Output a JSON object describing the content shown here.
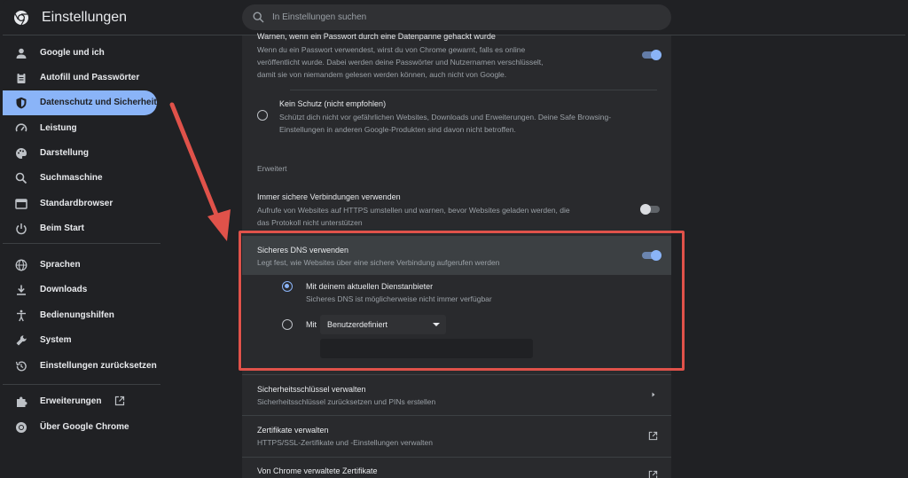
{
  "app": {
    "title": "Einstellungen"
  },
  "search": {
    "placeholder": "In Einstellungen suchen"
  },
  "sidebar": {
    "items": [
      {
        "label": "Google und ich",
        "icon": "person-icon"
      },
      {
        "label": "Autofill und Passwörter",
        "icon": "clipboard-icon"
      },
      {
        "label": "Datenschutz und Sicherheit",
        "icon": "shield-icon",
        "active": true
      },
      {
        "label": "Leistung",
        "icon": "speedometer-icon"
      },
      {
        "label": "Darstellung",
        "icon": "palette-icon"
      },
      {
        "label": "Suchmaschine",
        "icon": "search-icon"
      },
      {
        "label": "Standardbrowser",
        "icon": "browser-icon"
      },
      {
        "label": "Beim Start",
        "icon": "power-icon"
      },
      {
        "label": "Sprachen",
        "icon": "globe-icon"
      },
      {
        "label": "Downloads",
        "icon": "download-icon"
      },
      {
        "label": "Bedienungshilfen",
        "icon": "accessibility-icon"
      },
      {
        "label": "System",
        "icon": "wrench-icon"
      },
      {
        "label": "Einstellungen zurücksetzen",
        "icon": "history-icon"
      },
      {
        "label": "Erweiterungen",
        "icon": "puzzle-icon"
      },
      {
        "label": "Über Google Chrome",
        "icon": "chrome-icon"
      }
    ]
  },
  "content": {
    "breach_warning": {
      "title": "Warnen, wenn ein Passwort durch eine Datenpanne gehackt wurde",
      "desc_line1": "Wenn du ein Passwort verwendest, wirst du von Chrome gewarnt, falls es online",
      "desc_line2": "veröffentlicht wurde. Dabei werden deine Passwörter und Nutzernamen verschlüsselt,",
      "desc_line3": "damit sie von niemandem gelesen werden können, auch nicht von Google.",
      "enabled": true
    },
    "no_protection": {
      "title": "Kein Schutz (nicht empfohlen)",
      "desc_line1": "Schützt dich nicht vor gefährlichen Websites, Downloads und Erweiterungen. Deine Safe Browsing-",
      "desc_line2": "Einstellungen in anderen Google-Produkten sind davon nicht betroffen."
    },
    "advanced_heading": "Erweitert",
    "https_always": {
      "title": "Immer sichere Verbindungen verwenden",
      "desc_line1": "Aufrufe von Websites auf HTTPS umstellen und warnen, bevor Websites geladen werden, die",
      "desc_line2": "das Protokoll nicht unterstützen",
      "enabled": false
    },
    "secure_dns": {
      "title": "Sicheres DNS verwenden",
      "desc": "Legt fest, wie Websites über eine sichere Verbindung aufgerufen werden",
      "enabled": true,
      "option_current": {
        "title": "Mit deinem aktuellen Dienstanbieter",
        "desc": "Sicheres DNS ist möglicherweise nicht immer verfügbar"
      },
      "option_custom": {
        "prefix": "Mit",
        "selected": "Benutzerdefiniert"
      }
    },
    "security_keys": {
      "title": "Sicherheitsschlüssel verwalten",
      "desc": "Sicherheitsschlüssel zurücksetzen und PINs erstellen"
    },
    "certificates": {
      "title": "Zertifikate verwalten",
      "desc": "HTTPS/SSL-Zertifikate und -Einstellungen verwalten"
    },
    "chrome_certs": {
      "title": "Von Chrome verwaltete Zertifikate"
    }
  },
  "colors": {
    "accent": "#8ab4f8",
    "annotation": "#e0524a",
    "background": "#202124",
    "surface": "#292a2d"
  }
}
